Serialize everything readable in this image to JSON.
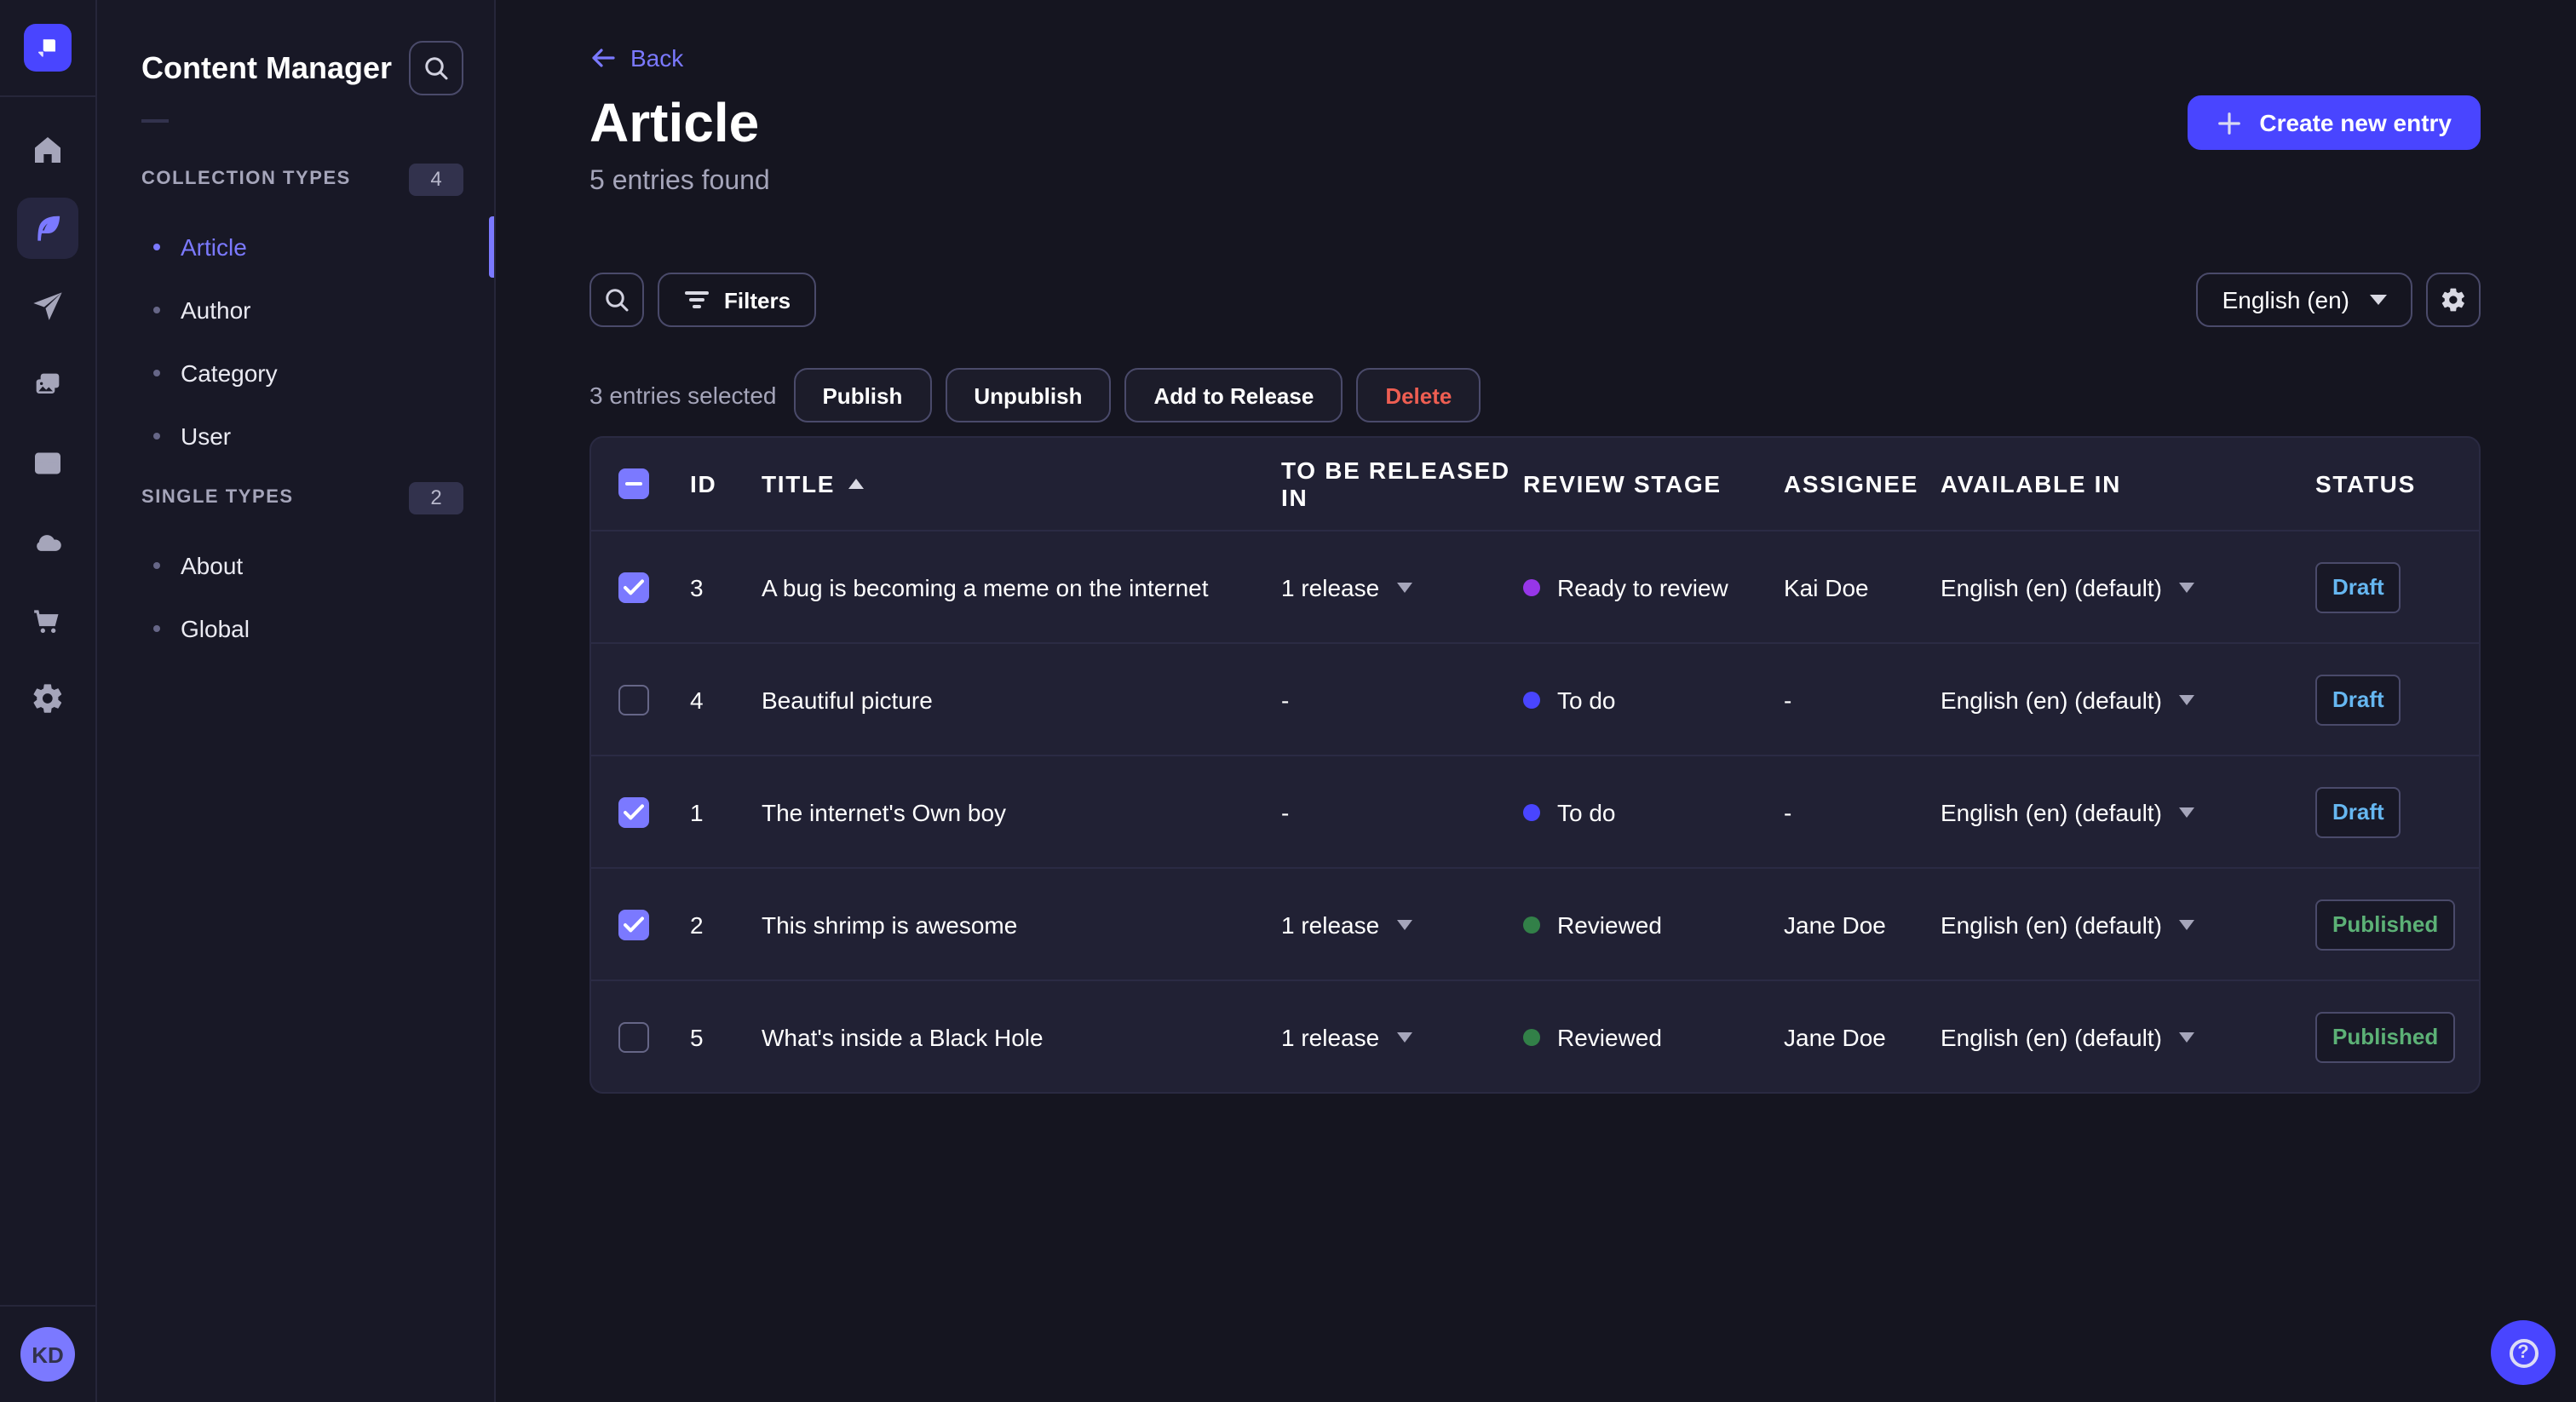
{
  "colors": {
    "accent": "#7b79ff",
    "primary": "#4945ff",
    "danger": "#ee5e52",
    "success": "#5cb176",
    "draft": "#66b7f1",
    "stage_todo": "#4945ff",
    "stage_ready": "#9736e8",
    "stage_reviewed": "#328048"
  },
  "nav_rail": {
    "icons": [
      "home",
      "content-manager",
      "releases",
      "media-library",
      "content-type-builder",
      "cloud",
      "marketplace",
      "settings"
    ],
    "active_icon": "content-manager",
    "avatar_initials": "KD"
  },
  "subnav": {
    "title": "Content Manager",
    "sections": [
      {
        "label": "COLLECTION TYPES",
        "badge": "4",
        "items": [
          {
            "label": "Article",
            "active": true
          },
          {
            "label": "Author",
            "active": false
          },
          {
            "label": "Category",
            "active": false
          },
          {
            "label": "User",
            "active": false
          }
        ]
      },
      {
        "label": "SINGLE TYPES",
        "badge": "2",
        "items": [
          {
            "label": "About",
            "active": false
          },
          {
            "label": "Global",
            "active": false
          }
        ]
      }
    ]
  },
  "header": {
    "back": "Back",
    "title": "Article",
    "subtitle": "5 entries found",
    "create_button": "Create new entry"
  },
  "toolbar": {
    "filters_label": "Filters",
    "locale": "English (en)"
  },
  "selection": {
    "text": "3 entries selected",
    "actions": [
      "Publish",
      "Unpublish",
      "Add to Release",
      "Delete"
    ]
  },
  "table": {
    "select_all_state": "indeterminate",
    "sort": {
      "column": "TITLE",
      "direction": "asc"
    },
    "columns": [
      "ID",
      "TITLE",
      "TO BE RELEASED IN",
      "REVIEW STAGE",
      "ASSIGNEE",
      "AVAILABLE IN",
      "STATUS"
    ],
    "rows": [
      {
        "checked": true,
        "id": "3",
        "title": "A bug is becoming a meme on the internet",
        "release": "1 release",
        "stage": "Ready to review",
        "stage_color": "#9736e8",
        "assignee": "Kai Doe",
        "locale": "English (en) (default)",
        "status": "Draft"
      },
      {
        "checked": false,
        "id": "4",
        "title": "Beautiful picture",
        "release": "-",
        "stage": "To do",
        "stage_color": "#4945ff",
        "assignee": "-",
        "locale": "English (en) (default)",
        "status": "Draft"
      },
      {
        "checked": true,
        "id": "1",
        "title": "The internet's Own boy",
        "release": "-",
        "stage": "To do",
        "stage_color": "#4945ff",
        "assignee": "-",
        "locale": "English (en) (default)",
        "status": "Draft"
      },
      {
        "checked": true,
        "id": "2",
        "title": "This shrimp is awesome",
        "release": "1 release",
        "stage": "Reviewed",
        "stage_color": "#328048",
        "assignee": "Jane Doe",
        "locale": "English (en) (default)",
        "status": "Published"
      },
      {
        "checked": false,
        "id": "5",
        "title": "What's inside a Black Hole",
        "release": "1 release",
        "stage": "Reviewed",
        "stage_color": "#328048",
        "assignee": "Jane Doe",
        "locale": "English (en) (default)",
        "status": "Published"
      }
    ]
  },
  "help": {
    "tooltip_icon": "question-mark"
  }
}
